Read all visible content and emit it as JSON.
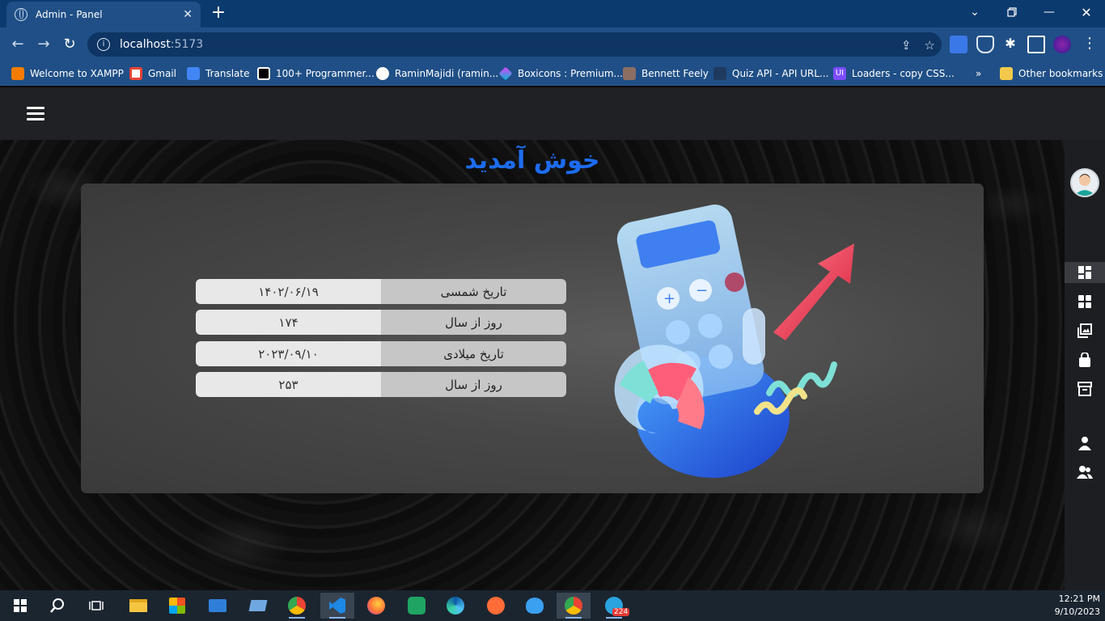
{
  "browser": {
    "tab_title": "Admin - Panel",
    "url_host": "localhost",
    "url_port": ":5173",
    "bookmarks": [
      {
        "label": "Welcome to XAMPP",
        "color": "#f57c00"
      },
      {
        "label": "Gmail",
        "color": "#ea4335"
      },
      {
        "label": "Translate",
        "color": "#4285f4"
      },
      {
        "label": "100+ Programmer...",
        "color": "#000000"
      },
      {
        "label": "RaminMajidi (ramin...",
        "color": "#ffffff"
      },
      {
        "label": "Boxicons : Premium...",
        "color": "#e040fb"
      },
      {
        "label": "Bennett Feely",
        "color": "#8d6e63"
      },
      {
        "label": "Quiz API - API URL...",
        "color": "#1e3a5f"
      },
      {
        "label": "Loaders - copy CSS...",
        "color": "#7c4dff"
      }
    ],
    "more_bookmarks": "»",
    "other_bookmarks": "Other bookmarks"
  },
  "page": {
    "welcome": "خوش آمدید",
    "rows": [
      {
        "label": "تاریخ شمسی",
        "value": "۱۴۰۲/۰۶/۱۹"
      },
      {
        "label": "روز از سال",
        "value": "۱۷۴"
      },
      {
        "label": "تاریخ میلادی",
        "value": "۲۰۲۳/۰۹/۱۰"
      },
      {
        "label": "روز از سال",
        "value": "۲۵۳"
      }
    ]
  },
  "sidebar": {
    "items": [
      "dashboard-icon",
      "grid-icon",
      "gallery-icon",
      "bag-icon",
      "archive-icon",
      "user-icon",
      "users-icon"
    ]
  },
  "taskbar": {
    "time": "12:21 PM",
    "date": "9/10/2023",
    "telegram_badge": "224"
  }
}
